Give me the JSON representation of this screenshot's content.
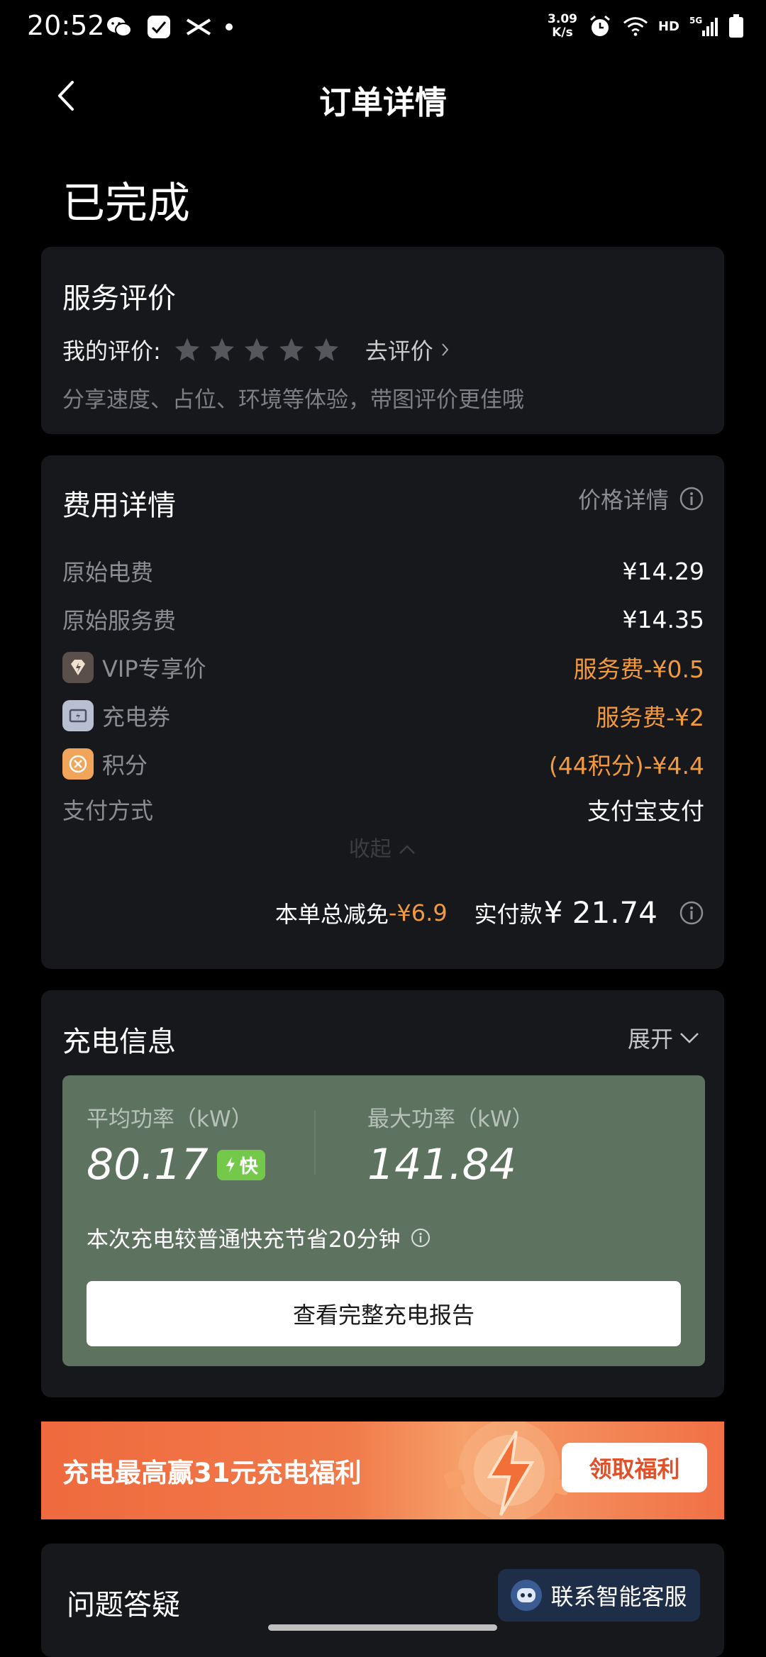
{
  "status_bar": {
    "time": "20:52",
    "network_speed_value": "3.09",
    "network_speed_unit": "K/s",
    "hd": "HD",
    "signal": "5G"
  },
  "nav": {
    "title": "订单详情"
  },
  "order": {
    "status": "已完成"
  },
  "rating": {
    "title": "服务评价",
    "label": "我的评价:",
    "stars_filled": 0,
    "stars_total": 5,
    "action": "去评价",
    "hint": "分享速度、占位、环境等体验，带图评价更佳哦"
  },
  "fees": {
    "title": "费用详情",
    "price_detail": "价格详情",
    "rows": [
      {
        "label": "原始电费",
        "value": "¥14.29"
      },
      {
        "label": "原始服务费",
        "value": "¥14.35"
      },
      {
        "label": "VIP专享价",
        "value": "服务费-¥0.5"
      },
      {
        "label": "充电券",
        "value": "服务费-¥2"
      },
      {
        "label": "积分",
        "value": "(44积分)-¥4.4"
      },
      {
        "label": "支付方式",
        "value": "支付宝支付"
      }
    ],
    "collapse": "收起",
    "discount_label": "本单总减免",
    "discount_value": "-¥6.9",
    "paid_label": "实付款",
    "paid_value": "¥ 21.74"
  },
  "charging": {
    "title": "充电信息",
    "expand": "展开",
    "avg_power_label": "平均功率（kW）",
    "avg_power_value": "80.17",
    "fast_badge": "快",
    "max_power_label": "最大功率（kW）",
    "max_power_value": "141.84",
    "save_text": "本次充电较普通快充节省20分钟",
    "report_button": "查看完整充电报告"
  },
  "promo": {
    "text": "充电最高赢31元充电福利",
    "button": "领取福利"
  },
  "qa": {
    "title": "问题答疑",
    "service_button": "联系智能客服"
  },
  "colors": {
    "accent_orange": "#f29a3d",
    "card_bg": "#17181b",
    "charge_panel": "#5e7260",
    "fast_green": "#74c94a"
  }
}
